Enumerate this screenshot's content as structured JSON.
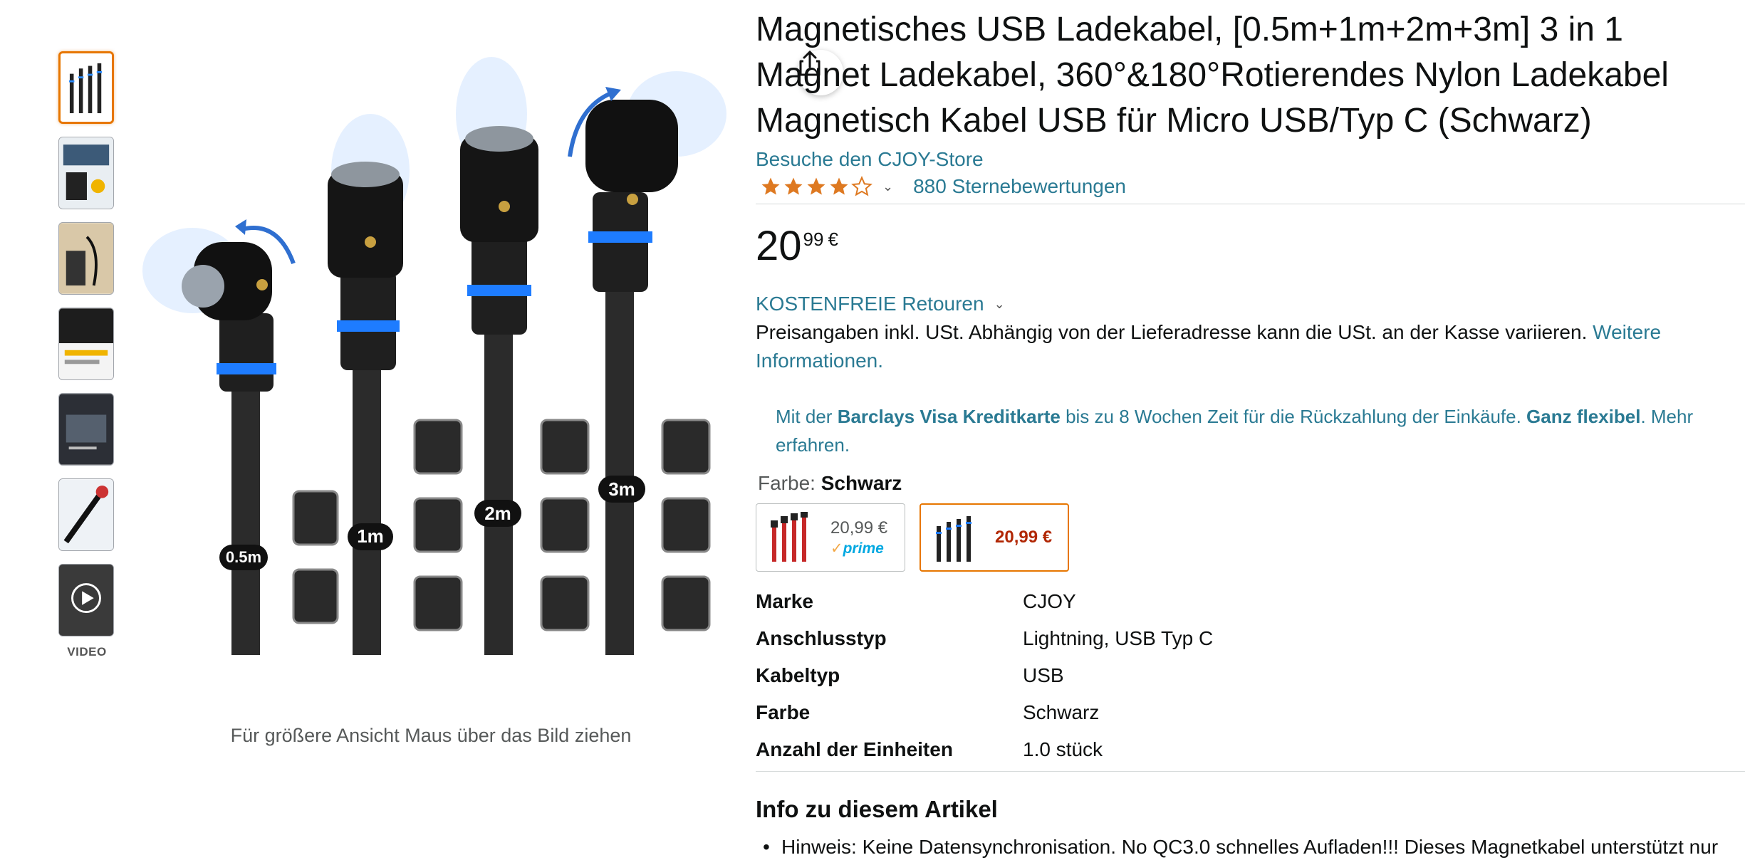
{
  "product": {
    "title": "Magnetisches USB Ladekabel, [0.5m+1m+2m+3m] 3 in 1 Magnet Ladekabel, 360°&180°Rotierendes Nylon Ladekabel Magnetisch Kabel USB für Micro USB/Typ C (Schwarz)",
    "store_link": "Besuche den CJOY-Store",
    "rating_stars": 4,
    "ratings_count_text": "880 Sternebewertungen",
    "price_whole": "20",
    "price_fraction": "99",
    "price_currency": "€",
    "returns_label": "KOSTENFREIE Retouren",
    "tax_text": "Preisangaben inkl. USt. Abhängig von der Lieferadresse kann die USt. an der Kasse variieren.",
    "tax_link": "Weitere Informationen."
  },
  "promo": {
    "prefix": "Mit der ",
    "card": "Barclays Visa Kreditkarte",
    "middle": " bis zu 8 Wochen Zeit für die Rückzahlung der Einkäufe. ",
    "bold_end": "Ganz flexibel",
    "suffix": ". Mehr erfahren."
  },
  "color": {
    "label": "Farbe: ",
    "value": "Schwarz",
    "options": [
      {
        "price": "20,99 €",
        "badge": "prime",
        "badge_check": "✓"
      },
      {
        "price": "20,99 €"
      }
    ]
  },
  "specs": [
    {
      "key": "Marke",
      "value": "CJOY"
    },
    {
      "key": "Anschlusstyp",
      "value": "Lightning, USB Typ C"
    },
    {
      "key": "Kabeltyp",
      "value": "USB"
    },
    {
      "key": "Farbe",
      "value": "Schwarz"
    },
    {
      "key": "Anzahl der Einheiten",
      "value": "1.0 stück"
    }
  ],
  "about": {
    "heading": "Info zu diesem Artikel",
    "first_bullet": "Hinweis: Keine Datensynchronisation. No QC3.0 schnelles Aufladen!!! Dieses Magnetkabel unterstützt nur"
  },
  "gallery": {
    "video_label": "VIDEO",
    "zoom_hint": "Für größere Ansicht Maus über das Bild ziehen",
    "cable_labels": [
      "0.5m",
      "1m",
      "2m",
      "3m"
    ]
  }
}
